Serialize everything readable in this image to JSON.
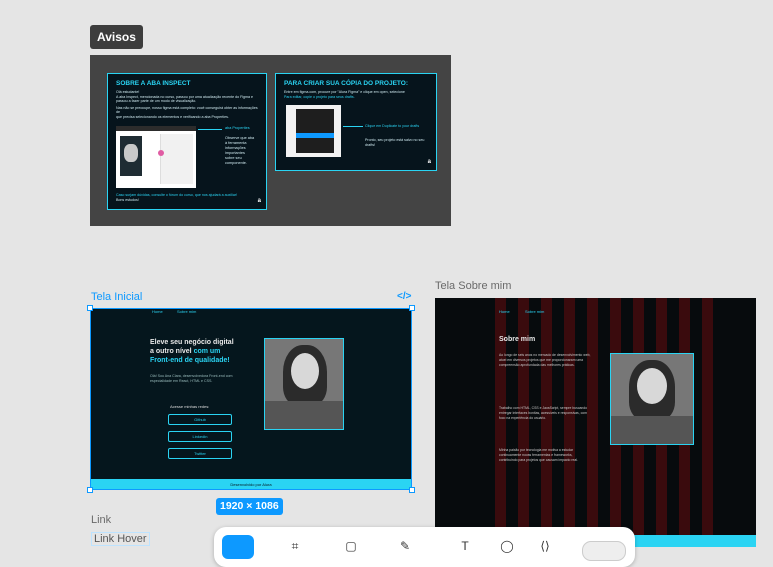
{
  "avisos": {
    "badge": "Avisos",
    "card1": {
      "title": "SOBRE A ABA INSPECT",
      "greeting": "Olá estudante!",
      "p1": "A aba Inspect, mencionada no curso, passou por uma atualização recente do Figma e",
      "p1b": "passou a fazer parte de um modo de visualização.",
      "p2": "Nas não se preocupe, nosso figma está completo: você conseguirá obter as informações de",
      "p2b": "que precisa selecionando os elementos e verificando a aba Properties.",
      "arrow_label": "aba Properties",
      "side_text": "Observe que aba à ferramenta informações importantes sobre seu componente.",
      "footer": "Caso surjam dúvidas, consulte o fórum do curso, que nos ajudará a auxiliar!",
      "footer2": "Bons estudos!",
      "logo": "a"
    },
    "card2": {
      "title": "PARA CRIAR SUA CÓPIA DO PROJETO:",
      "p1": "Entre em figma.com, procure por ”Alura Figma” e clique em open, selecione",
      "p1b": "Para editar, copie o projeto para seus drafts.",
      "note1": "Clique em Duplicate to your drafts",
      "note2": "Pronto, seu projeto está salvo no seu drafts!",
      "logo": "a"
    }
  },
  "frames": {
    "tela_inicial_label": "Tela Inicial",
    "tela_sobre_label": "Tela Sobre mim",
    "code_icon": "</>",
    "size_badge": "1920 × 1086"
  },
  "tela_inicial": {
    "nav": [
      "Home",
      "Sobre mim"
    ],
    "headline_a": "Eleve seu negócio digital",
    "headline_b": "a outro nível ",
    "headline_c": "com um",
    "headline_d": "Front-end de qualidade!",
    "body": "Olá! Sou Ana Clara, desenvolvedora Front-end com especialidade em React, HTML e CSS.",
    "cta_title": "Acesse minhas redes:",
    "btn1": "Github",
    "btn2": "Linkedin",
    "btn3": "Twitter",
    "footer": "Desenvolvido por Alura"
  },
  "tela_sobre": {
    "nav": [
      "Home",
      "Sobre mim"
    ],
    "title": "Sobre mim",
    "p1": "Ao longo de seis anos no mercado de desenvolvimento web, atuei em diversos projetos que me proporcionaram uma compreensão aprofundada das melhores práticas.",
    "p2": "Trabalho com HTML, CSS e JavaScript, sempre buscando entregar interfaces bonitas, acessíveis e responsivas, com foco na experiência do usuário.",
    "p3": "Minha paixão por tecnologia me motiva a estudar continuamente novas ferramentas e frameworks, contribuindo para projetos que causam impacto real."
  },
  "sidebar_links": {
    "link": "Link",
    "link_hover": "Link Hover"
  },
  "colors": {
    "accent": "#2ad4f3",
    "selection": "#0d99ff",
    "dark": "#05161d",
    "stripe": "#3a0b0d"
  },
  "toolbar": {
    "icons": [
      "move-icon",
      "frame-icon",
      "rect-icon",
      "pen-icon",
      "text-icon",
      "comment-icon",
      "dev-mode-icon",
      "toggle"
    ]
  }
}
